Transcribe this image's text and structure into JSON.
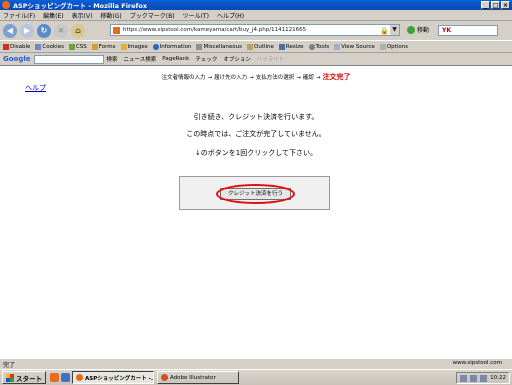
{
  "window": {
    "title": "ASPショッピングカート - Mozilla Firefox",
    "buttons": [
      "_",
      "□",
      "×"
    ]
  },
  "menu": [
    "ファイル(F)",
    "編集(E)",
    "表示(V)",
    "移動(G)",
    "ブックマーク(B)",
    "ツール(T)",
    "ヘルプ(H)"
  ],
  "nav": {
    "url": "https://www.sipstool.com/kameyama/cart/buy_j4.php/1141121665",
    "go_label": "移動",
    "search_value": "YK"
  },
  "devbar": [
    "Disable",
    "Cookies",
    "CSS",
    "Forms",
    "Images",
    "Information",
    "Miscellaneous",
    "Outline",
    "Resize",
    "Tools",
    "View Source",
    "Options"
  ],
  "googlebar": {
    "logo": "Google",
    "items": [
      "検索",
      "ニュース検索",
      "PageRank",
      "チェック",
      "オプション"
    ],
    "disabled_item": "ハイライト"
  },
  "content": {
    "steps": [
      "注文者情報の入力",
      "届け先の入力",
      "支払方法の選択",
      "確認"
    ],
    "current_step": "注文完了",
    "arrow": "→",
    "help_link": "ヘルプ",
    "message1": "引き続き、クレジット決済を行います。",
    "message2": "この時点では、ご注文が完了していません。",
    "message3": "↓のボタンを1回クリックして下さい。",
    "pay_button": "クレジット決済を行う"
  },
  "status": {
    "text": "完了",
    "host": "www.sipstool.com"
  },
  "taskbar": {
    "start": "スタート",
    "tasks": [
      "ASPショッピングカート -...",
      "Adobe Illustrator"
    ],
    "clock": "10:22"
  }
}
